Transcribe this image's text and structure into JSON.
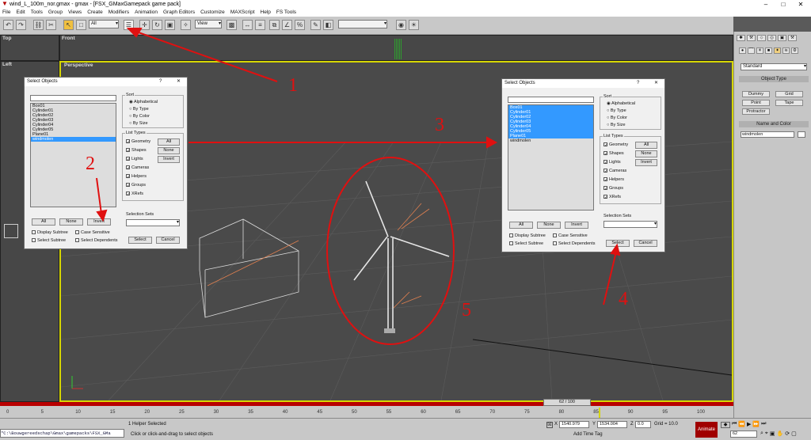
{
  "window": {
    "title": "wind_L_100m_nor.gmax - gmax - [FSX_GMaxGamepack game pack]",
    "controls": [
      "–",
      "□",
      "✕"
    ]
  },
  "menu": [
    "File",
    "Edit",
    "Tools",
    "Group",
    "Views",
    "Create",
    "Modifiers",
    "Animation",
    "Graph Editors",
    "Customize",
    "MAXScript",
    "Help",
    "FS Tools"
  ],
  "toolbar": {
    "filter_select": "All",
    "ref_coord": "View"
  },
  "viewports": {
    "top": "Top",
    "front": "Front",
    "left": "Left",
    "perspective": "Perspective"
  },
  "command_panel": {
    "dropdown": "Standard",
    "object_type_header": "Object Type",
    "object_buttons": [
      "Dummy",
      "Grid",
      "Point",
      "Tape",
      "Protractor"
    ],
    "name_color_header": "Name and Color",
    "name_value": "windmolen"
  },
  "dialog_left": {
    "title": "Select Objects",
    "help": "?",
    "close": "✕",
    "items": [
      "Box01",
      "Cylinder01",
      "Cylinder02",
      "Cylinder03",
      "Cylinder04",
      "Cylinder05",
      "Plane01",
      "windmolen"
    ],
    "selected_index": 7,
    "sort_label": "Sort",
    "sort_options": [
      "Alphabetical",
      "By Type",
      "By Color",
      "By Size"
    ],
    "list_types_label": "List Types",
    "list_types": [
      "Geometry",
      "Shapes",
      "Lights",
      "Cameras",
      "Helpers",
      "Groups",
      "XRefs"
    ],
    "lt_buttons": [
      "All",
      "None",
      "Invert"
    ],
    "bottom_buttons": [
      "All",
      "None",
      "Invert"
    ],
    "options": [
      "Display Subtree",
      "Case Sensitive",
      "Select Subtree",
      "Select Dependents"
    ],
    "selection_sets_label": "Selection Sets",
    "select_button": "Select",
    "cancel_button": "Cancel"
  },
  "dialog_right": {
    "title": "Select Objects",
    "help": "?",
    "close": "✕",
    "items": [
      "Box01",
      "Cylinder01",
      "Cylinder02",
      "Cylinder03",
      "Cylinder04",
      "Cylinder05",
      "Plane01",
      "windmolen"
    ],
    "selected_count": 7,
    "sort_label": "Sort",
    "sort_options": [
      "Alphabetical",
      "By Type",
      "By Color",
      "By Size"
    ],
    "list_types_label": "List Types",
    "list_types": [
      "Geometry",
      "Shapes",
      "Lights",
      "Cameras",
      "Helpers",
      "Groups",
      "XRefs"
    ],
    "lt_buttons": [
      "All",
      "None",
      "Invert"
    ],
    "bottom_buttons": [
      "All",
      "None",
      "Invert"
    ],
    "options": [
      "Display Subtree",
      "Case Sensitive",
      "Select Subtree",
      "Select Dependents"
    ],
    "selection_sets_label": "Selection Sets",
    "select_button": "Select",
    "cancel_button": "Cancel"
  },
  "annotations": [
    "1",
    "2",
    "3",
    "4",
    "5"
  ],
  "annotation_color": "#e01010",
  "timeline": {
    "frame_display": "62 / 100",
    "ticks": [
      "0",
      "5",
      "10",
      "15",
      "20",
      "25",
      "30",
      "35",
      "40",
      "45",
      "50",
      "55",
      "60",
      "65",
      "70",
      "75",
      "80",
      "85",
      "90",
      "95",
      "100"
    ]
  },
  "status": {
    "maxscript": "\"C:\\Bouwgereedschap\\Gmax\\gamepacks\\FSX_GMa",
    "selected": "1 Helper Selected",
    "prompt": "Click or click-and-drag to select objects",
    "x_label": "X",
    "x_value": "1540.979",
    "y_label": "Y",
    "y_value": "1534.004",
    "z_label": "Z",
    "z_value": "0.0",
    "grid": "Grid = 10.0",
    "add_time_tag": "Add Time Tag",
    "animate": "Animate",
    "frame": "62"
  },
  "colors": {
    "viewport_active": "#d7d700",
    "selection": "#3399ff",
    "trackbar_red": "#b80000",
    "animate_btn": "#a00000"
  }
}
